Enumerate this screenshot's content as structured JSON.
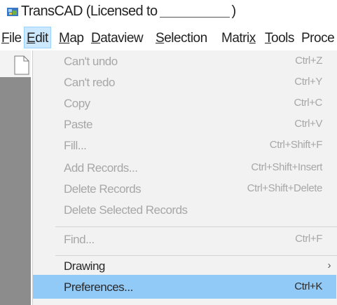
{
  "window": {
    "title_prefix": "TransCAD (Licensed to",
    "title_suffix": ")"
  },
  "menubar": {
    "items": [
      {
        "label": "File",
        "mnemonic": "F",
        "rest": "ile"
      },
      {
        "label": "Edit",
        "mnemonic": "E",
        "rest": "dit"
      },
      {
        "label": "Map",
        "mnemonic": "M",
        "rest": "ap"
      },
      {
        "label": "Dataview",
        "mnemonic": "D",
        "rest": "ataview"
      },
      {
        "label": "Selection",
        "mnemonic": "S",
        "rest": "election"
      },
      {
        "label": "Matrix",
        "pre": "Matri",
        "mnemonic": "x",
        "rest": ""
      },
      {
        "label": "Tools",
        "mnemonic": "T",
        "rest": "ools"
      },
      {
        "label": "Proce",
        "text": "Proce"
      }
    ]
  },
  "edit_menu": {
    "items": [
      {
        "label": "Can't undo",
        "shortcut": "Ctrl+Z",
        "enabled": false
      },
      {
        "label": "Can't redo",
        "shortcut": "Ctrl+Y",
        "enabled": false
      },
      {
        "label": "Copy",
        "shortcut": "Ctrl+C",
        "enabled": false
      },
      {
        "label": "Paste",
        "shortcut": "Ctrl+V",
        "enabled": false
      },
      {
        "label": "Fill...",
        "shortcut": "Ctrl+Shift+F",
        "enabled": false
      },
      {
        "label": "Add Records...",
        "shortcut": "Ctrl+Shift+Insert",
        "enabled": false
      },
      {
        "label": "Delete Records",
        "shortcut": "Ctrl+Shift+Delete",
        "enabled": false
      },
      {
        "label": "Delete Selected Records",
        "shortcut": "",
        "enabled": false
      },
      {
        "label": "Find...",
        "shortcut": "Ctrl+F",
        "enabled": false
      },
      {
        "label": "Drawing",
        "shortcut": "",
        "enabled": true,
        "submenu_arrow": "›"
      },
      {
        "label": "Preferences...",
        "shortcut": "Ctrl+K",
        "enabled": true,
        "highlighted": true
      }
    ]
  },
  "colors": {
    "menu_background": "#f2f2f2",
    "highlight": "#91c9f7",
    "disabled_text": "#a7a7a7",
    "menubar_selected": "#cce8ff"
  }
}
